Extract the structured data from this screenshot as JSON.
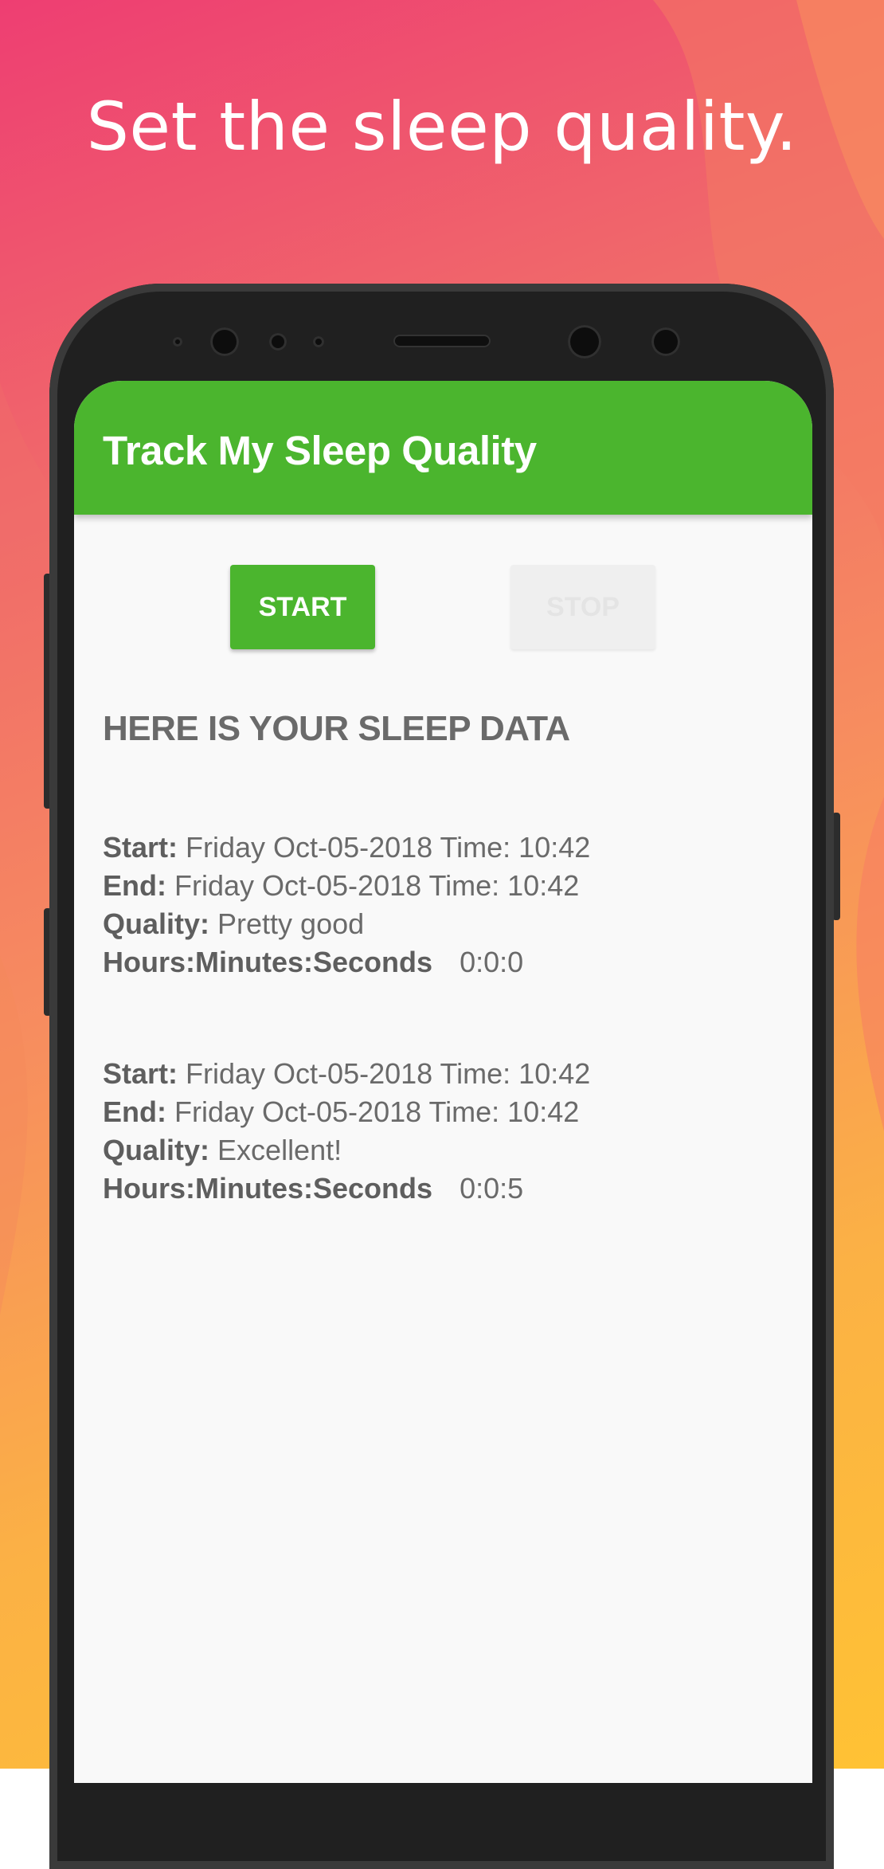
{
  "headline": "Set the sleep quality.",
  "colors": {
    "accent_green": "#4bb52e",
    "background_top": "#ee3e72",
    "background_bottom": "#ffc234"
  },
  "app": {
    "title": "Track My Sleep Quality",
    "start_label": "START",
    "stop_label": "STOP",
    "section_title": "HERE IS YOUR SLEEP DATA"
  },
  "records": [
    {
      "start_label": "Start:",
      "start_value": "Friday Oct-05-2018 Time: 10:42",
      "end_label": "End:",
      "end_value": "Friday Oct-05-2018 Time: 10:42",
      "quality_label": "Quality:",
      "quality_value": "Pretty good",
      "hms_label": "Hours:Minutes:Seconds",
      "hms_value": "0:0:0"
    },
    {
      "start_label": "Start:",
      "start_value": "Friday Oct-05-2018 Time: 10:42",
      "end_label": "End:",
      "end_value": "Friday Oct-05-2018 Time: 10:42",
      "quality_label": "Quality:",
      "quality_value": "Excellent!",
      "hms_label": "Hours:Minutes:Seconds",
      "hms_value": "0:0:5"
    }
  ]
}
